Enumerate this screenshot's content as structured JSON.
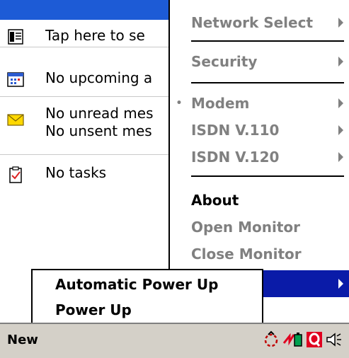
{
  "today": {
    "items": [
      {
        "icon": "owner-info-icon",
        "text": "Tap here to se"
      },
      {
        "icon": "calendar-icon",
        "text": "No upcoming a"
      },
      {
        "icon": "envelope-icon",
        "text": "No unread mes",
        "text2": "No unsent mes"
      },
      {
        "icon": "tasks-icon",
        "text": "No tasks"
      }
    ]
  },
  "menu": {
    "items": [
      {
        "label": "Network Select",
        "state": "disabled",
        "submenu": true
      },
      {
        "label": "Security",
        "state": "disabled",
        "submenu": true
      },
      {
        "label": "Modem",
        "state": "disabled",
        "submenu": true,
        "checked": true
      },
      {
        "label": "ISDN V.110",
        "state": "disabled",
        "submenu": true
      },
      {
        "label": "ISDN V.120",
        "state": "disabled",
        "submenu": true
      },
      {
        "label": "About",
        "state": "enabled",
        "submenu": false
      },
      {
        "label": "Open Monitor",
        "state": "disabled",
        "submenu": false
      },
      {
        "label": "Close Monitor",
        "state": "disabled",
        "submenu": false
      },
      {
        "label": "",
        "state": "highlighted",
        "submenu": true
      }
    ],
    "radio_mark": "•"
  },
  "submenu": {
    "items": [
      {
        "label": "Automatic Power Up"
      },
      {
        "label": "Power Up"
      }
    ]
  },
  "taskbar": {
    "new_label": "New",
    "tray_icons": [
      "connection-icon",
      "battery-icon",
      "app-q-icon",
      "speaker-icon"
    ]
  },
  "colors": {
    "header_blue": "#1d5bd6",
    "highlight": "#0a1ba8",
    "disabled_text": "#808080",
    "taskbar": "#d4d0c8"
  }
}
